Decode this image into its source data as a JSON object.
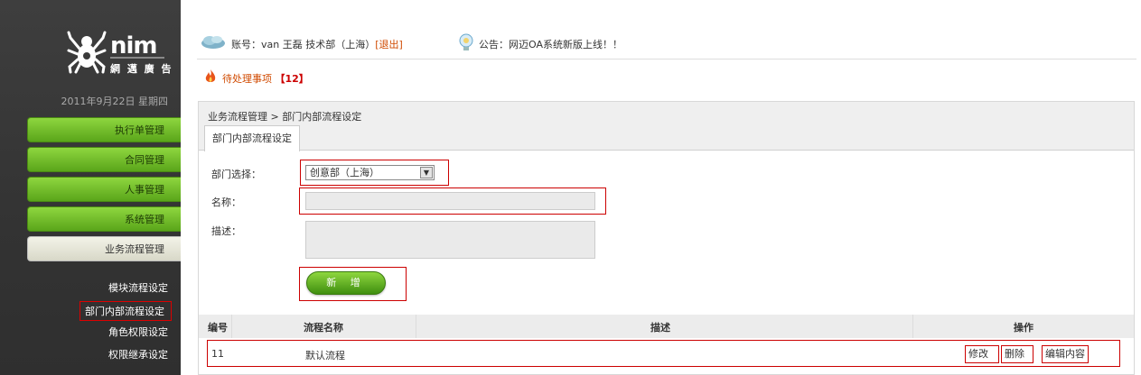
{
  "sidebar": {
    "logo": {
      "brand": "nim",
      "sub": "網 邁 廣 告"
    },
    "date": "2011年9月22日  星期四",
    "menu": [
      {
        "label": "执行单管理"
      },
      {
        "label": "合同管理"
      },
      {
        "label": "人事管理"
      },
      {
        "label": "系统管理"
      },
      {
        "label": "业务流程管理"
      }
    ],
    "submenu": [
      {
        "label": "模块流程设定"
      },
      {
        "label": "部门内部流程设定"
      },
      {
        "label": "角色权限设定"
      },
      {
        "label": "权限继承设定"
      }
    ]
  },
  "header": {
    "account": "账号：van  王磊  技术部（上海）",
    "logout": "[退出]",
    "notice": "公告：网迈OA系统新版上线！！",
    "pending_label": "待处理事项",
    "pending_count": "【12】"
  },
  "panel": {
    "breadcrumb": "业务流程管理  >  部门内部流程设定",
    "tab": "部门内部流程设定",
    "form": {
      "dept_label": "部门选择：",
      "dept_value": "创意部（上海）",
      "name_label": "名称：",
      "name_value": "",
      "desc_label": "描述：",
      "desc_value": "",
      "add_button": "新 增"
    },
    "table": {
      "headers": [
        "编号",
        "流程名称",
        "描述",
        "操作"
      ],
      "rows": [
        {
          "id": "11",
          "name": "默认流程",
          "desc": "",
          "actions": [
            "修改",
            "删除",
            "编辑内容"
          ]
        }
      ]
    }
  },
  "colors": {
    "accent_green": "#6cba2a",
    "highlight_red": "#cc0000",
    "link_orange": "#d04a00"
  }
}
